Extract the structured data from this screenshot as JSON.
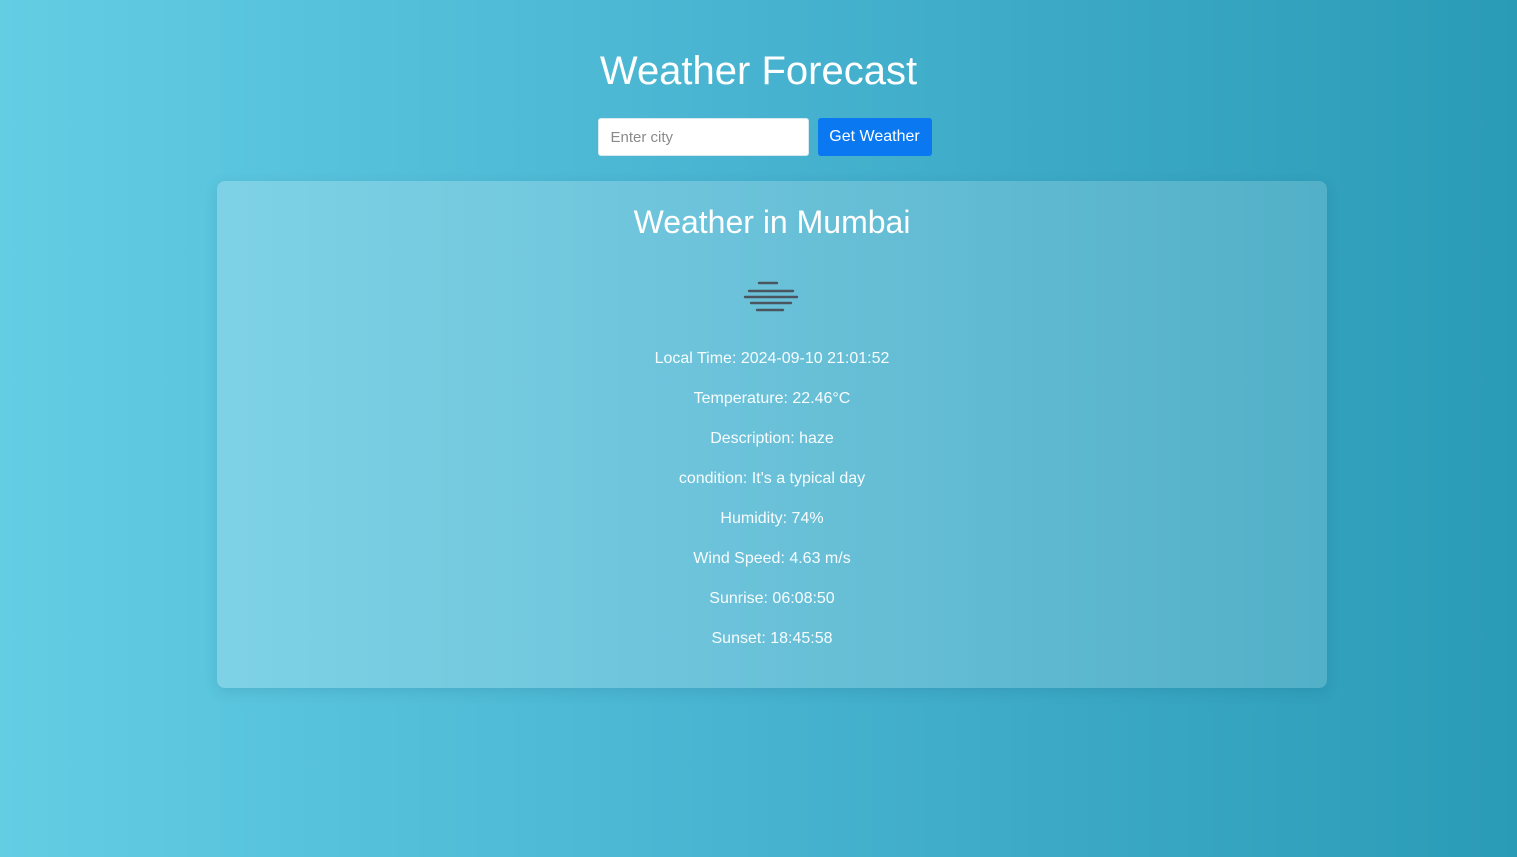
{
  "header": {
    "title": "Weather Forecast"
  },
  "search": {
    "placeholder": "Enter city",
    "value": "",
    "button_label": "Get Weather"
  },
  "card": {
    "title": "Weather in Mumbai",
    "icon": "haze-icon",
    "details": [
      "Local Time: 2024-09-10 21:01:52",
      "Temperature: 22.46°C",
      "Description: haze",
      "condition: It's a typical day",
      "Humidity: 74%",
      "Wind Speed: 4.63 m/s",
      "Sunrise: 06:08:50",
      "Sunset: 18:45:58"
    ]
  },
  "colors": {
    "button": "#0a78f0",
    "background_start": "#63cde4",
    "background_end": "#2a9bb6"
  }
}
